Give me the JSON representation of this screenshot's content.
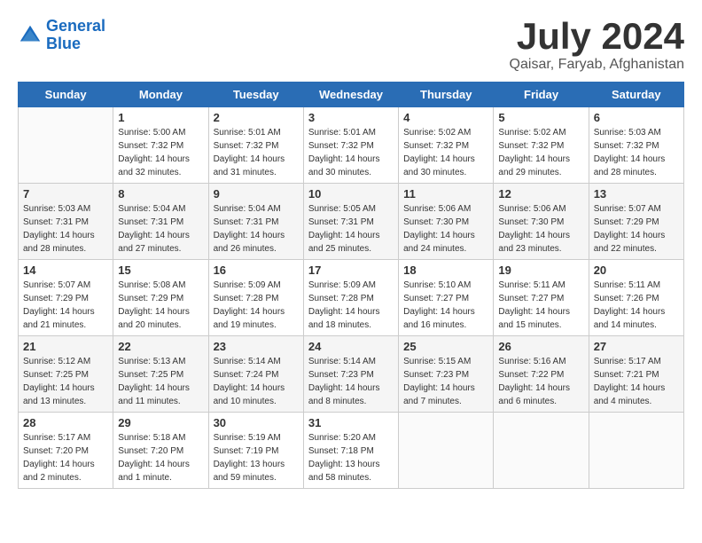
{
  "header": {
    "logo_line1": "General",
    "logo_line2": "Blue",
    "month_year": "July 2024",
    "location": "Qaisar, Faryab, Afghanistan"
  },
  "weekdays": [
    "Sunday",
    "Monday",
    "Tuesday",
    "Wednesday",
    "Thursday",
    "Friday",
    "Saturday"
  ],
  "weeks": [
    [
      {
        "day": "",
        "sunrise": "",
        "sunset": "",
        "daylight": ""
      },
      {
        "day": "1",
        "sunrise": "Sunrise: 5:00 AM",
        "sunset": "Sunset: 7:32 PM",
        "daylight": "Daylight: 14 hours and 32 minutes."
      },
      {
        "day": "2",
        "sunrise": "Sunrise: 5:01 AM",
        "sunset": "Sunset: 7:32 PM",
        "daylight": "Daylight: 14 hours and 31 minutes."
      },
      {
        "day": "3",
        "sunrise": "Sunrise: 5:01 AM",
        "sunset": "Sunset: 7:32 PM",
        "daylight": "Daylight: 14 hours and 30 minutes."
      },
      {
        "day": "4",
        "sunrise": "Sunrise: 5:02 AM",
        "sunset": "Sunset: 7:32 PM",
        "daylight": "Daylight: 14 hours and 30 minutes."
      },
      {
        "day": "5",
        "sunrise": "Sunrise: 5:02 AM",
        "sunset": "Sunset: 7:32 PM",
        "daylight": "Daylight: 14 hours and 29 minutes."
      },
      {
        "day": "6",
        "sunrise": "Sunrise: 5:03 AM",
        "sunset": "Sunset: 7:32 PM",
        "daylight": "Daylight: 14 hours and 28 minutes."
      }
    ],
    [
      {
        "day": "7",
        "sunrise": "Sunrise: 5:03 AM",
        "sunset": "Sunset: 7:31 PM",
        "daylight": "Daylight: 14 hours and 28 minutes."
      },
      {
        "day": "8",
        "sunrise": "Sunrise: 5:04 AM",
        "sunset": "Sunset: 7:31 PM",
        "daylight": "Daylight: 14 hours and 27 minutes."
      },
      {
        "day": "9",
        "sunrise": "Sunrise: 5:04 AM",
        "sunset": "Sunset: 7:31 PM",
        "daylight": "Daylight: 14 hours and 26 minutes."
      },
      {
        "day": "10",
        "sunrise": "Sunrise: 5:05 AM",
        "sunset": "Sunset: 7:31 PM",
        "daylight": "Daylight: 14 hours and 25 minutes."
      },
      {
        "day": "11",
        "sunrise": "Sunrise: 5:06 AM",
        "sunset": "Sunset: 7:30 PM",
        "daylight": "Daylight: 14 hours and 24 minutes."
      },
      {
        "day": "12",
        "sunrise": "Sunrise: 5:06 AM",
        "sunset": "Sunset: 7:30 PM",
        "daylight": "Daylight: 14 hours and 23 minutes."
      },
      {
        "day": "13",
        "sunrise": "Sunrise: 5:07 AM",
        "sunset": "Sunset: 7:29 PM",
        "daylight": "Daylight: 14 hours and 22 minutes."
      }
    ],
    [
      {
        "day": "14",
        "sunrise": "Sunrise: 5:07 AM",
        "sunset": "Sunset: 7:29 PM",
        "daylight": "Daylight: 14 hours and 21 minutes."
      },
      {
        "day": "15",
        "sunrise": "Sunrise: 5:08 AM",
        "sunset": "Sunset: 7:29 PM",
        "daylight": "Daylight: 14 hours and 20 minutes."
      },
      {
        "day": "16",
        "sunrise": "Sunrise: 5:09 AM",
        "sunset": "Sunset: 7:28 PM",
        "daylight": "Daylight: 14 hours and 19 minutes."
      },
      {
        "day": "17",
        "sunrise": "Sunrise: 5:09 AM",
        "sunset": "Sunset: 7:28 PM",
        "daylight": "Daylight: 14 hours and 18 minutes."
      },
      {
        "day": "18",
        "sunrise": "Sunrise: 5:10 AM",
        "sunset": "Sunset: 7:27 PM",
        "daylight": "Daylight: 14 hours and 16 minutes."
      },
      {
        "day": "19",
        "sunrise": "Sunrise: 5:11 AM",
        "sunset": "Sunset: 7:27 PM",
        "daylight": "Daylight: 14 hours and 15 minutes."
      },
      {
        "day": "20",
        "sunrise": "Sunrise: 5:11 AM",
        "sunset": "Sunset: 7:26 PM",
        "daylight": "Daylight: 14 hours and 14 minutes."
      }
    ],
    [
      {
        "day": "21",
        "sunrise": "Sunrise: 5:12 AM",
        "sunset": "Sunset: 7:25 PM",
        "daylight": "Daylight: 14 hours and 13 minutes."
      },
      {
        "day": "22",
        "sunrise": "Sunrise: 5:13 AM",
        "sunset": "Sunset: 7:25 PM",
        "daylight": "Daylight: 14 hours and 11 minutes."
      },
      {
        "day": "23",
        "sunrise": "Sunrise: 5:14 AM",
        "sunset": "Sunset: 7:24 PM",
        "daylight": "Daylight: 14 hours and 10 minutes."
      },
      {
        "day": "24",
        "sunrise": "Sunrise: 5:14 AM",
        "sunset": "Sunset: 7:23 PM",
        "daylight": "Daylight: 14 hours and 8 minutes."
      },
      {
        "day": "25",
        "sunrise": "Sunrise: 5:15 AM",
        "sunset": "Sunset: 7:23 PM",
        "daylight": "Daylight: 14 hours and 7 minutes."
      },
      {
        "day": "26",
        "sunrise": "Sunrise: 5:16 AM",
        "sunset": "Sunset: 7:22 PM",
        "daylight": "Daylight: 14 hours and 6 minutes."
      },
      {
        "day": "27",
        "sunrise": "Sunrise: 5:17 AM",
        "sunset": "Sunset: 7:21 PM",
        "daylight": "Daylight: 14 hours and 4 minutes."
      }
    ],
    [
      {
        "day": "28",
        "sunrise": "Sunrise: 5:17 AM",
        "sunset": "Sunset: 7:20 PM",
        "daylight": "Daylight: 14 hours and 2 minutes."
      },
      {
        "day": "29",
        "sunrise": "Sunrise: 5:18 AM",
        "sunset": "Sunset: 7:20 PM",
        "daylight": "Daylight: 14 hours and 1 minute."
      },
      {
        "day": "30",
        "sunrise": "Sunrise: 5:19 AM",
        "sunset": "Sunset: 7:19 PM",
        "daylight": "Daylight: 13 hours and 59 minutes."
      },
      {
        "day": "31",
        "sunrise": "Sunrise: 5:20 AM",
        "sunset": "Sunset: 7:18 PM",
        "daylight": "Daylight: 13 hours and 58 minutes."
      },
      {
        "day": "",
        "sunrise": "",
        "sunset": "",
        "daylight": ""
      },
      {
        "day": "",
        "sunrise": "",
        "sunset": "",
        "daylight": ""
      },
      {
        "day": "",
        "sunrise": "",
        "sunset": "",
        "daylight": ""
      }
    ]
  ]
}
